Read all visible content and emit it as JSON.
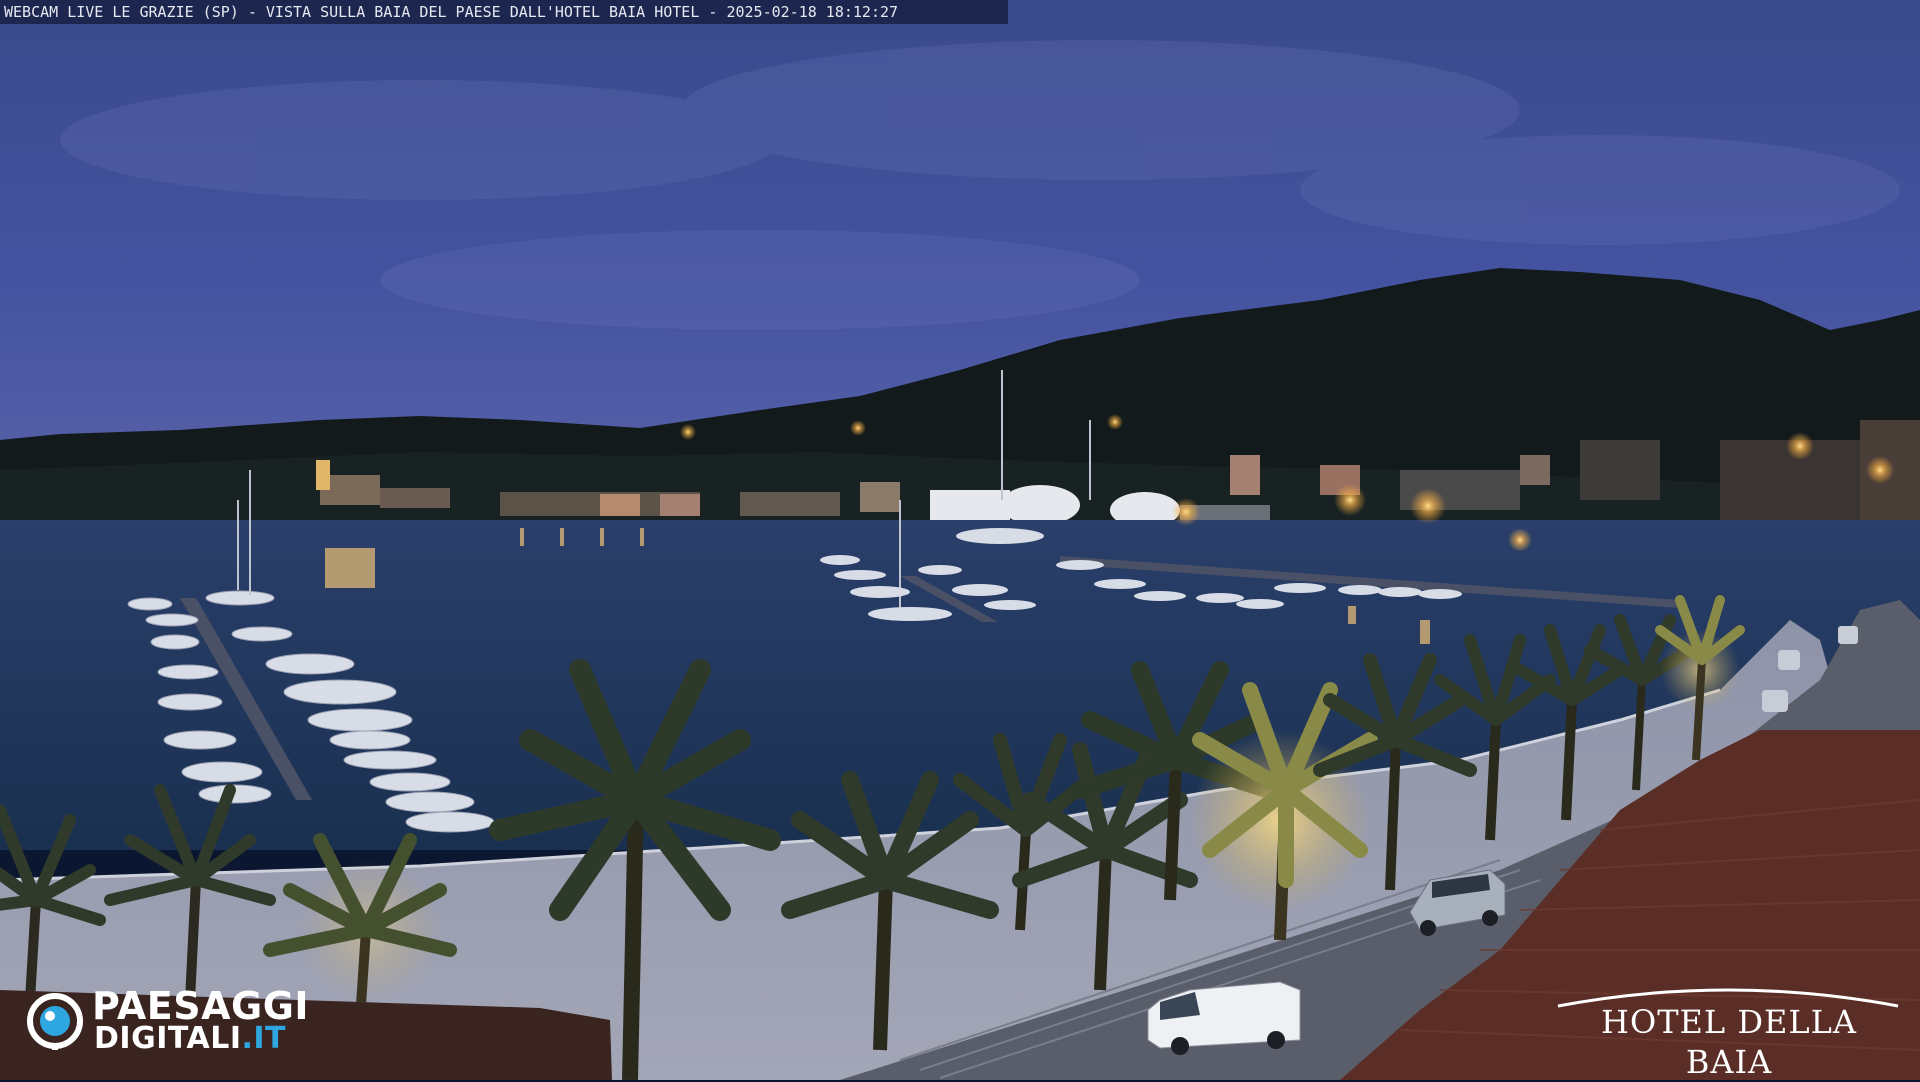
{
  "overlay": {
    "title": "WEBCAM LIVE LE GRAZIE (SP) - VISTA SULLA BAIA DEL PAESE DALL'HOTEL BAIA HOTEL - 2025-02-18 18:12:27"
  },
  "logo_left": {
    "line1": "PAESAGGI",
    "line2_main": "DIGITALI",
    "line2_accent": ".IT",
    "accent_color": "#2ea7e0"
  },
  "logo_right": {
    "name": "HOTEL DELLA BAIA"
  },
  "colors": {
    "sky_top": "#3a4a8a",
    "sky_bottom": "#4a5aa0",
    "water": "#1f3a5e",
    "hill": "#141c1c",
    "light": "#ffb347",
    "roof": "#5a2a22"
  }
}
